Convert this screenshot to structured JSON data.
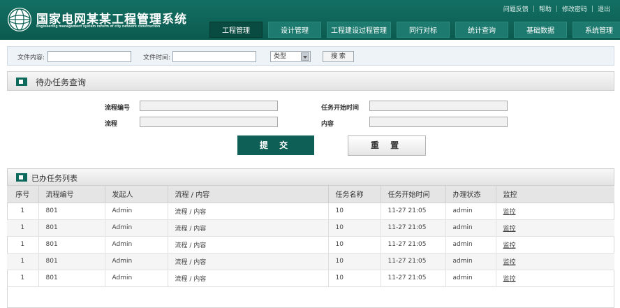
{
  "app": {
    "title": "国家电网某某工程管理系统",
    "subtitle": "Engineering management system reform of city network construction"
  },
  "toplinks": [
    {
      "label": "问题反馈"
    },
    {
      "label": "帮助"
    },
    {
      "label": "修改密码"
    },
    {
      "label": "退出"
    }
  ],
  "nav": [
    {
      "label": "工程管理",
      "active": true
    },
    {
      "label": "设计管理"
    },
    {
      "label": "工程建设过程管理"
    },
    {
      "label": "同行对标"
    },
    {
      "label": "统计查询"
    },
    {
      "label": "基础数据"
    },
    {
      "label": "系统管理"
    }
  ],
  "filter": {
    "content_label": "文件内容:",
    "content_value": "",
    "time_label": "文件时间:",
    "time_value": "",
    "type_select": "类型",
    "search_button": "搜 索"
  },
  "pending": {
    "title": "待办任务查询",
    "process_no_label": "流程编号",
    "process_no_value": "",
    "process_label": "流程",
    "process_value": "",
    "start_time_label": "任务开始时间",
    "start_time_value": "",
    "content_label": "内容",
    "content_value": "",
    "submit_button": "提 交",
    "reset_button": "重 置"
  },
  "done": {
    "title": "已办任务列表",
    "columns": [
      "序号",
      "流程编号",
      "发起人",
      "流程 / 内容",
      "任务名称",
      "任务开始时间",
      "办理状态",
      "监控"
    ],
    "rows": [
      [
        "1",
        "801",
        "Admin",
        "流程 / 内容",
        "10",
        "11-27 21:05",
        "admin",
        "监控"
      ],
      [
        "1",
        "801",
        "Admin",
        "流程 / 内容",
        "10",
        "11-27 21:05",
        "admin",
        "监控"
      ],
      [
        "1",
        "801",
        "Admin",
        "流程 / 内容",
        "10",
        "11-27 21:05",
        "admin",
        "监控"
      ],
      [
        "1",
        "801",
        "Admin",
        "流程 / 内容",
        "10",
        "11-27 21:05",
        "admin",
        "监控"
      ],
      [
        "1",
        "801",
        "Admin",
        "流程 / 内容",
        "10",
        "11-27 21:05",
        "admin",
        "监控"
      ]
    ]
  },
  "colors": {
    "header_bg": "#0e6457",
    "nav_active": "#0a4b41",
    "accent": "#0e5f55"
  }
}
